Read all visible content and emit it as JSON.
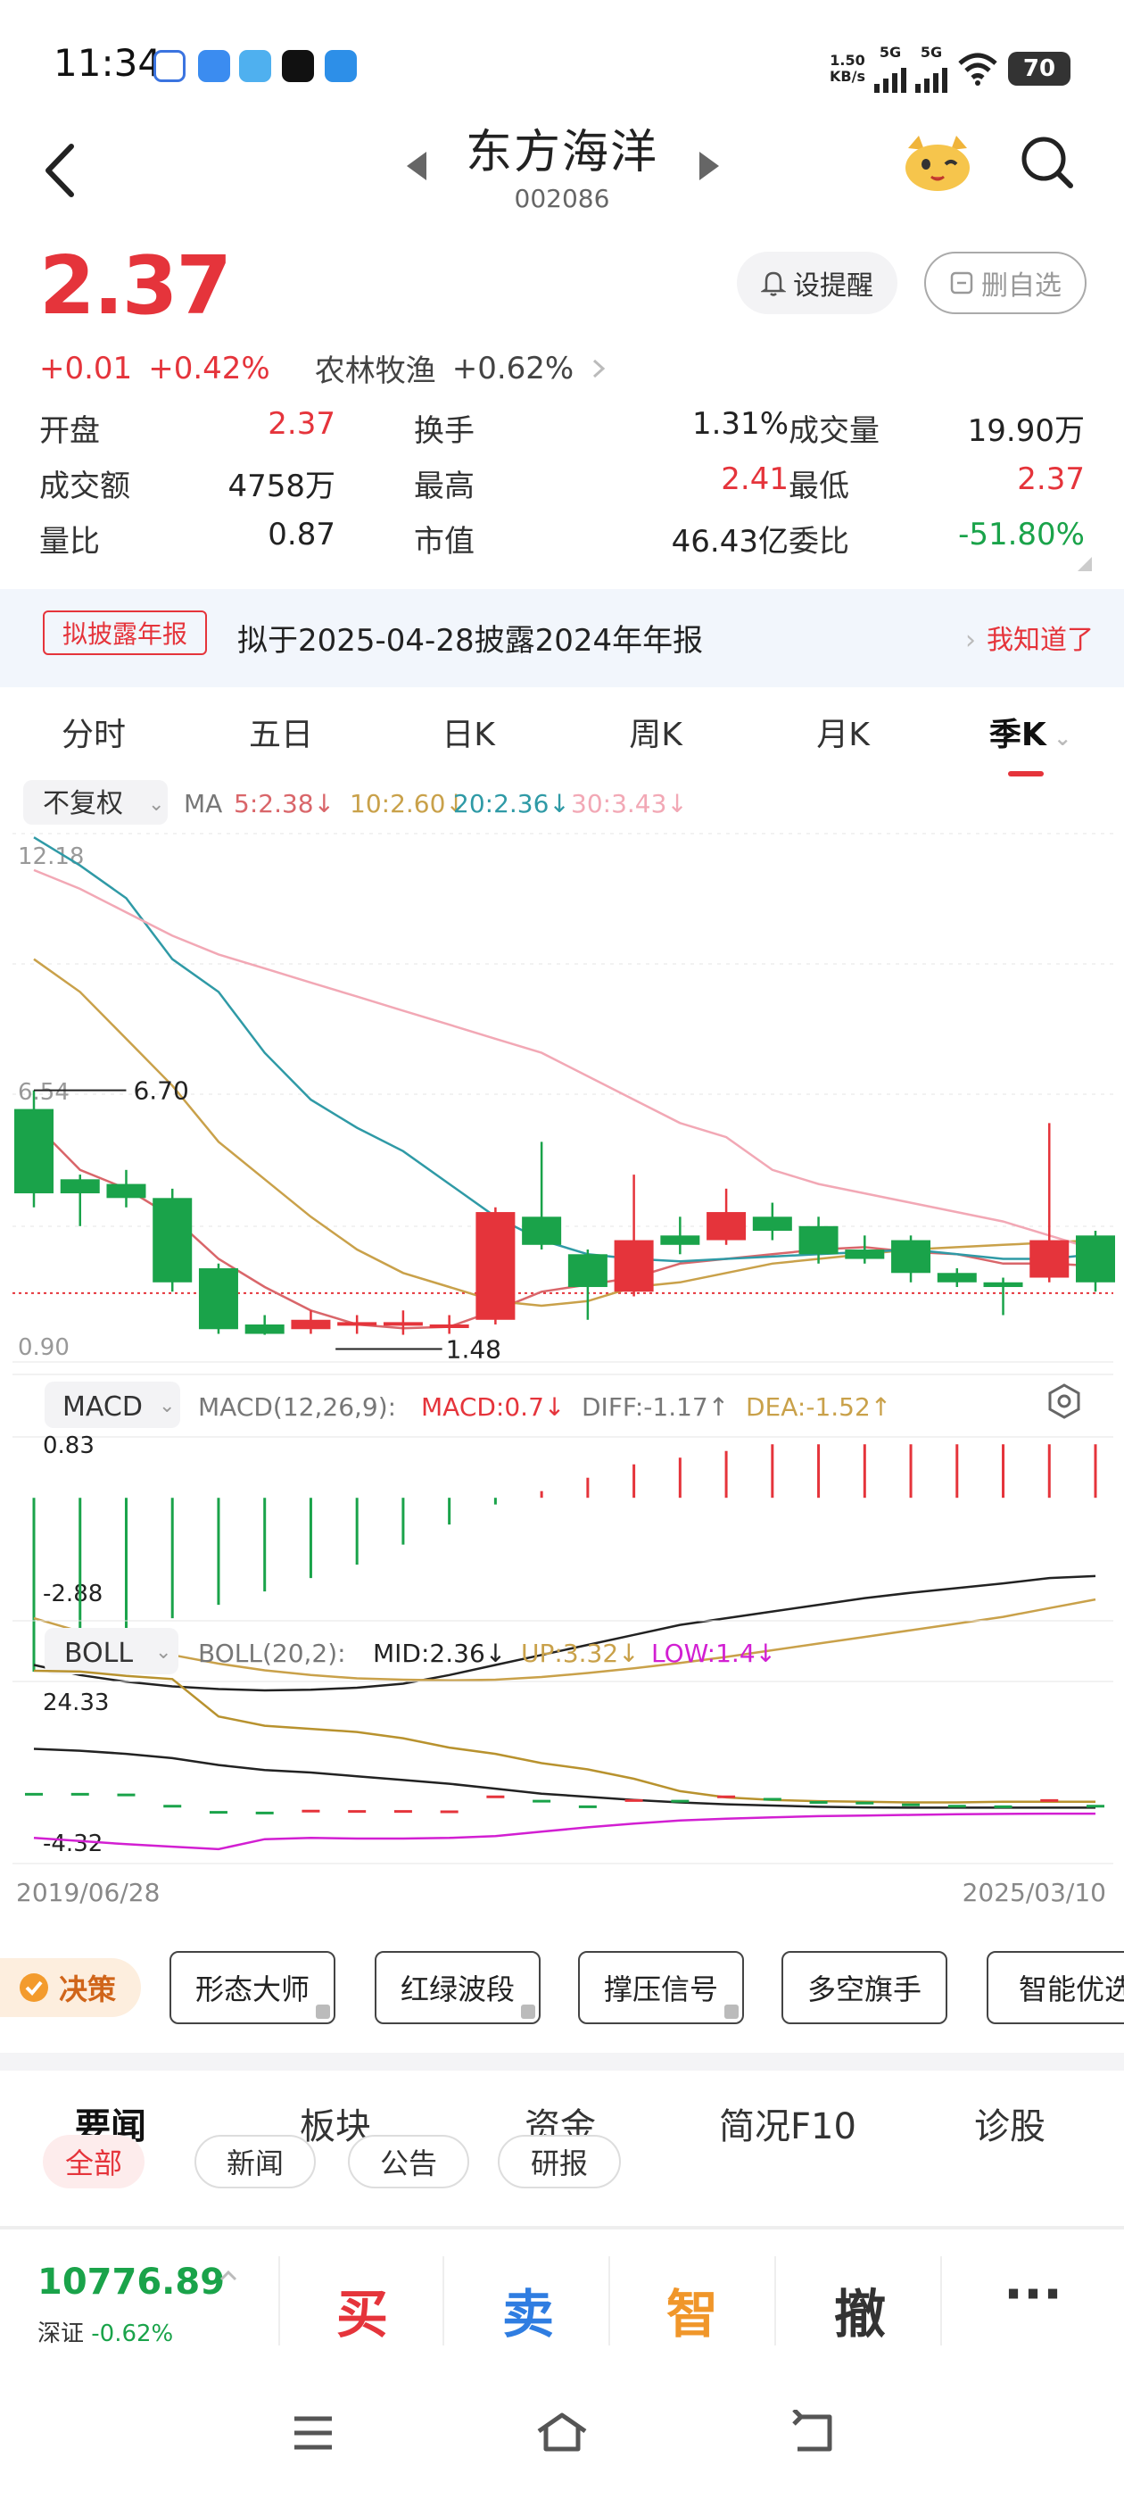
{
  "status_bar": {
    "time": "11:34",
    "net_speed_value": "1.50",
    "net_speed_unit": "KB/s",
    "sim1": "5G",
    "sim2": "5G",
    "battery": "70"
  },
  "header": {
    "title": "东方海洋",
    "code": "002086"
  },
  "quote": {
    "price": "2.37",
    "change": "+0.01",
    "change_pct": "+0.42%",
    "sector_name": "农林牧渔",
    "sector_pct": "+0.62%",
    "alert_button": "设提醒",
    "watchlist_button": "删自选",
    "color_up": "#e5343b",
    "color_down": "#1aa34a"
  },
  "stats": [
    [
      {
        "k": "开盘",
        "v": "2.37",
        "c": "red"
      },
      {
        "k": "换手",
        "v": "1.31%",
        "c": "dark"
      },
      {
        "k": "成交量",
        "v": "19.90万",
        "c": "dark"
      }
    ],
    [
      {
        "k": "成交额",
        "v": "4758万",
        "c": "dark"
      },
      {
        "k": "最高",
        "v": "2.41",
        "c": "red"
      },
      {
        "k": "最低",
        "v": "2.37",
        "c": "red"
      }
    ],
    [
      {
        "k": "量比",
        "v": "0.87",
        "c": "dark"
      },
      {
        "k": "市值",
        "v": "46.43亿",
        "c": "dark"
      },
      {
        "k": "委比",
        "v": "-51.80%",
        "c": "green"
      }
    ]
  ],
  "notice": {
    "badge": "拟披露年报",
    "text": "拟于2025-04-28披露2024年年报",
    "action": "我知道了"
  },
  "kline_tabs": [
    "分时",
    "五日",
    "日K",
    "周K",
    "月K",
    "季K"
  ],
  "kline_active": "季K",
  "chart_controls": {
    "adjust": "不复权",
    "ma_label": "MA",
    "ma5": "5:2.38↓",
    "ma10": "10:2.60↓",
    "ma20": "20:2.36↓",
    "ma30": "30:3.43↓",
    "macd_selector": "MACD",
    "macd_params": "MACD(12,26,9):",
    "macd_val": "MACD:0.7↓",
    "diff_val": "DIFF:-1.17↑",
    "dea_val": "DEA:-1.52↑",
    "boll_selector": "BOLL",
    "boll_params": "BOLL(20,2):",
    "boll_mid": "MID:2.36↓",
    "boll_up": "UP:3.32↓",
    "boll_low": "LOW:1.4↓",
    "date_start": "2019/06/28",
    "date_end": "2025/03/10"
  },
  "chart_data": {
    "type": "candlestick",
    "x_start": "2019/06/28",
    "x_end": "2025/03/10",
    "price_axis_labels": [
      "12.18",
      "6.54",
      "0.90"
    ],
    "price_ylim": [
      0.9,
      12.18
    ],
    "annotations": {
      "high_label": "6.70",
      "low_label": "1.48"
    },
    "candles": [
      {
        "o": 6.3,
        "c": 4.5,
        "h": 6.7,
        "l": 4.2
      },
      {
        "o": 4.8,
        "c": 4.5,
        "h": 4.9,
        "l": 3.8
      },
      {
        "o": 4.7,
        "c": 4.4,
        "h": 5.0,
        "l": 4.2
      },
      {
        "o": 4.4,
        "c": 2.6,
        "h": 4.6,
        "l": 2.4
      },
      {
        "o": 2.9,
        "c": 1.6,
        "h": 3.0,
        "l": 1.5
      },
      {
        "o": 1.7,
        "c": 1.5,
        "h": 1.9,
        "l": 1.48
      },
      {
        "o": 1.6,
        "c": 1.8,
        "h": 2.0,
        "l": 1.5
      },
      {
        "o": 1.7,
        "c": 1.75,
        "h": 1.9,
        "l": 1.5
      },
      {
        "o": 1.7,
        "c": 1.75,
        "h": 2.0,
        "l": 1.48
      },
      {
        "o": 1.7,
        "c": 1.7,
        "h": 1.9,
        "l": 1.5
      },
      {
        "o": 1.8,
        "c": 4.1,
        "h": 4.2,
        "l": 1.7
      },
      {
        "o": 4.0,
        "c": 3.4,
        "h": 5.6,
        "l": 3.3
      },
      {
        "o": 3.2,
        "c": 2.5,
        "h": 3.3,
        "l": 1.8
      },
      {
        "o": 2.4,
        "c": 3.5,
        "h": 4.9,
        "l": 2.3
      },
      {
        "o": 3.6,
        "c": 3.4,
        "h": 4.0,
        "l": 3.2
      },
      {
        "o": 3.5,
        "c": 4.1,
        "h": 4.6,
        "l": 3.4
      },
      {
        "o": 4.0,
        "c": 3.7,
        "h": 4.3,
        "l": 3.5
      },
      {
        "o": 3.8,
        "c": 3.2,
        "h": 4.0,
        "l": 3.0
      },
      {
        "o": 3.3,
        "c": 3.1,
        "h": 3.6,
        "l": 3.0
      },
      {
        "o": 3.5,
        "c": 2.8,
        "h": 3.6,
        "l": 2.6
      },
      {
        "o": 2.8,
        "c": 2.6,
        "h": 2.9,
        "l": 2.5
      },
      {
        "o": 2.6,
        "c": 2.5,
        "h": 2.7,
        "l": 1.9
      },
      {
        "o": 2.7,
        "c": 3.5,
        "h": 6.0,
        "l": 2.6
      },
      {
        "o": 3.6,
        "c": 2.6,
        "h": 3.7,
        "l": 2.4
      }
    ],
    "ma_series": [
      {
        "name": "MA5",
        "color": "#d9666a",
        "values": [
          6.0,
          5.0,
          4.6,
          4.0,
          3.1,
          2.5,
          2.0,
          1.7,
          1.62,
          1.65,
          2.0,
          2.4,
          2.55,
          2.7,
          3.0,
          3.1,
          3.2,
          3.3,
          3.35,
          3.25,
          3.2,
          3.0,
          3.0,
          2.95
        ]
      },
      {
        "name": "MA10",
        "color": "#c9a14a",
        "values": [
          9.5,
          8.8,
          7.8,
          6.8,
          5.6,
          4.8,
          4.0,
          3.3,
          2.8,
          2.5,
          2.2,
          2.1,
          2.2,
          2.5,
          2.6,
          2.8,
          3.0,
          3.1,
          3.2,
          3.3,
          3.35,
          3.4,
          3.45,
          3.5
        ]
      },
      {
        "name": "MA20",
        "color": "#2f9aa6",
        "values": [
          12.1,
          11.5,
          10.8,
          9.5,
          8.8,
          7.5,
          6.5,
          5.9,
          5.4,
          4.7,
          4.0,
          3.5,
          3.2,
          3.1,
          3.05,
          3.1,
          3.15,
          3.2,
          3.25,
          3.3,
          3.2,
          3.1,
          3.1,
          3.2
        ]
      },
      {
        "name": "MA30",
        "color": "#f2a8b5",
        "values": [
          11.4,
          11.0,
          10.5,
          10.0,
          9.6,
          9.3,
          9.0,
          8.7,
          8.4,
          8.1,
          7.8,
          7.5,
          7.0,
          6.5,
          6.0,
          5.7,
          5.0,
          4.7,
          4.5,
          4.3,
          4.1,
          3.9,
          3.6,
          3.3
        ]
      }
    ],
    "macd_axis_labels": [
      "0.83",
      "-2.88"
    ],
    "macd_ylim": [
      -2.88,
      0.83
    ],
    "macd_bars": [
      -2.6,
      -2.3,
      -2.0,
      -1.8,
      -1.6,
      -1.4,
      -1.2,
      -1.0,
      -0.7,
      -0.4,
      -0.1,
      0.1,
      0.3,
      0.5,
      0.6,
      0.7,
      0.8,
      0.8,
      0.8,
      0.8,
      0.8,
      0.8,
      0.8,
      0.8
    ],
    "diff": [
      -2.5,
      -2.65,
      -2.75,
      -2.82,
      -2.86,
      -2.88,
      -2.87,
      -2.84,
      -2.78,
      -2.65,
      -2.5,
      -2.35,
      -2.2,
      -2.05,
      -1.9,
      -1.8,
      -1.7,
      -1.6,
      -1.5,
      -1.42,
      -1.35,
      -1.28,
      -1.2,
      -1.17
    ],
    "dea": [
      -1.8,
      -2.0,
      -2.2,
      -2.35,
      -2.48,
      -2.58,
      -2.65,
      -2.7,
      -2.72,
      -2.73,
      -2.72,
      -2.68,
      -2.62,
      -2.55,
      -2.47,
      -2.38,
      -2.28,
      -2.18,
      -2.08,
      -1.98,
      -1.88,
      -1.78,
      -1.65,
      -1.52
    ],
    "boll_axis_labels": [
      "24.33",
      "-4.32"
    ],
    "boll_ylim": [
      -4.32,
      24.33
    ],
    "boll_up": [
      24.33,
      24.2,
      23.5,
      23.0,
      17.0,
      15.5,
      15.0,
      14.5,
      13.5,
      12.0,
      11.0,
      9.5,
      8.5,
      7.0,
      5.0,
      4.0,
      3.6,
      3.4,
      3.3,
      3.2,
      3.2,
      3.3,
      3.32,
      3.32
    ],
    "boll_mid": [
      11.8,
      11.5,
      11.0,
      10.3,
      9.2,
      8.4,
      8.0,
      7.4,
      6.8,
      6.2,
      5.4,
      4.6,
      4.1,
      3.6,
      3.2,
      2.9,
      2.7,
      2.5,
      2.4,
      2.35,
      2.35,
      2.36,
      2.36,
      2.36
    ],
    "boll_low": [
      -2.5,
      -3.0,
      -3.5,
      -3.9,
      -4.3,
      -2.7,
      -2.5,
      -2.6,
      -2.6,
      -2.5,
      -2.2,
      -1.5,
      -0.8,
      -0.2,
      0.3,
      0.6,
      0.8,
      1.0,
      1.1,
      1.2,
      1.3,
      1.35,
      1.4,
      1.4
    ]
  },
  "decision": {
    "label": "决策",
    "chips": [
      "形态大师",
      "红绿波段",
      "撑压信号",
      "多空旗手",
      "智能优选"
    ]
  },
  "news_tabs": [
    "要闻",
    "板块",
    "资金",
    "简况F10",
    "诊股"
  ],
  "news_subtabs": [
    "全部",
    "新闻",
    "公告",
    "研报"
  ],
  "bottom": {
    "index_value": "10776.89",
    "index_name": "深证",
    "index_pct": "-0.62%",
    "buy": "买",
    "sell": "卖",
    "smart": "智",
    "cancel": "撤",
    "more": "···"
  }
}
